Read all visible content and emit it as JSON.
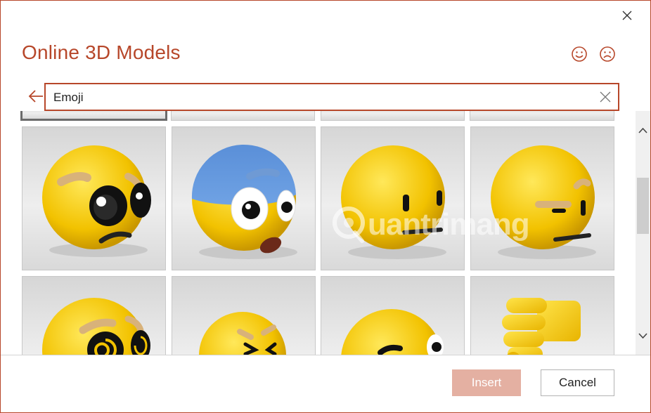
{
  "dialog": {
    "title": "Online 3D Models",
    "accent_color": "#b7472a",
    "close_icon": "close-icon",
    "feedback": {
      "smile_icon": "smile-icon",
      "frown_icon": "frown-icon"
    }
  },
  "search": {
    "back_icon": "back-arrow-icon",
    "value": "Emoji",
    "clear_icon": "clear-icon"
  },
  "results": {
    "tiles": [
      {
        "icon": "partial-tile",
        "selected": true
      },
      {
        "icon": "partial-tile"
      },
      {
        "icon": "partial-tile"
      },
      {
        "icon": "partial-tile"
      },
      {
        "icon": "pleading-face-emoji-icon"
      },
      {
        "icon": "flushed-blue-face-emoji-icon"
      },
      {
        "icon": "neutral-face-emoji-icon"
      },
      {
        "icon": "raised-eyebrow-face-emoji-icon"
      },
      {
        "icon": "dizzy-face-emoji-icon"
      },
      {
        "icon": "squinting-face-emoji-icon"
      },
      {
        "icon": "sunglasses-face-emoji-icon"
      },
      {
        "icon": "thumbs-down-emoji-icon"
      }
    ]
  },
  "watermark": {
    "text": "uantrimang"
  },
  "footer": {
    "insert_label": "Insert",
    "cancel_label": "Cancel",
    "insert_color": "#e4b0a2"
  }
}
